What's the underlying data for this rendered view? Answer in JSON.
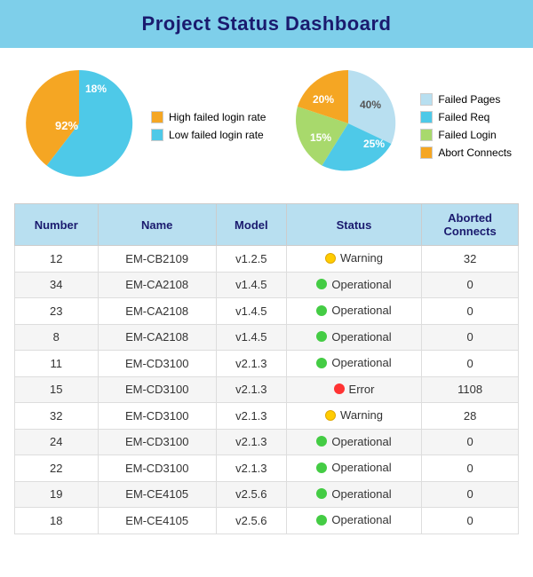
{
  "header": {
    "title": "Project Status Dashboard"
  },
  "chart1": {
    "slices": [
      {
        "label": "High failed login rate",
        "percent": "18%",
        "color": "#f5a623"
      },
      {
        "label": "Low failed login rate",
        "percent": "92%",
        "color": "#4ec9e8"
      }
    ]
  },
  "chart2": {
    "slices": [
      {
        "label": "Failed Pages",
        "percent": "40%",
        "color": "#b8dff0"
      },
      {
        "label": "Failed Req",
        "percent": "25%",
        "color": "#4ec9e8"
      },
      {
        "label": "Failed Login",
        "percent": "15%",
        "color": "#a8d96c"
      },
      {
        "label": "Abort Connects",
        "percent": "20%",
        "color": "#f5a623"
      }
    ]
  },
  "table": {
    "columns": [
      "Number",
      "Name",
      "Model",
      "Status",
      "Aborted Connects"
    ],
    "rows": [
      {
        "number": "12",
        "name": "EM-CB2109",
        "model": "v1.2.5",
        "status": "Warning",
        "status_type": "warning",
        "aborted": "32"
      },
      {
        "number": "34",
        "name": "EM-CA2108",
        "model": "v1.4.5",
        "status": "Operational",
        "status_type": "operational",
        "aborted": "0"
      },
      {
        "number": "23",
        "name": "EM-CA2108",
        "model": "v1.4.5",
        "status": "Operational",
        "status_type": "operational",
        "aborted": "0"
      },
      {
        "number": "8",
        "name": "EM-CA2108",
        "model": "v1.4.5",
        "status": "Operational",
        "status_type": "operational",
        "aborted": "0"
      },
      {
        "number": "11",
        "name": "EM-CD3100",
        "model": "v2.1.3",
        "status": "Operational",
        "status_type": "operational",
        "aborted": "0"
      },
      {
        "number": "15",
        "name": "EM-CD3100",
        "model": "v2.1.3",
        "status": "Error",
        "status_type": "error",
        "aborted": "1108"
      },
      {
        "number": "32",
        "name": "EM-CD3100",
        "model": "v2.1.3",
        "status": "Warning",
        "status_type": "warning",
        "aborted": "28"
      },
      {
        "number": "24",
        "name": "EM-CD3100",
        "model": "v2.1.3",
        "status": "Operational",
        "status_type": "operational",
        "aborted": "0"
      },
      {
        "number": "22",
        "name": "EM-CD3100",
        "model": "v2.1.3",
        "status": "Operational",
        "status_type": "operational",
        "aborted": "0"
      },
      {
        "number": "19",
        "name": "EM-CE4105",
        "model": "v2.5.6",
        "status": "Operational",
        "status_type": "operational",
        "aborted": "0"
      },
      {
        "number": "18",
        "name": "EM-CE4105",
        "model": "v2.5.6",
        "status": "Operational",
        "status_type": "operational",
        "aborted": "0"
      }
    ]
  }
}
